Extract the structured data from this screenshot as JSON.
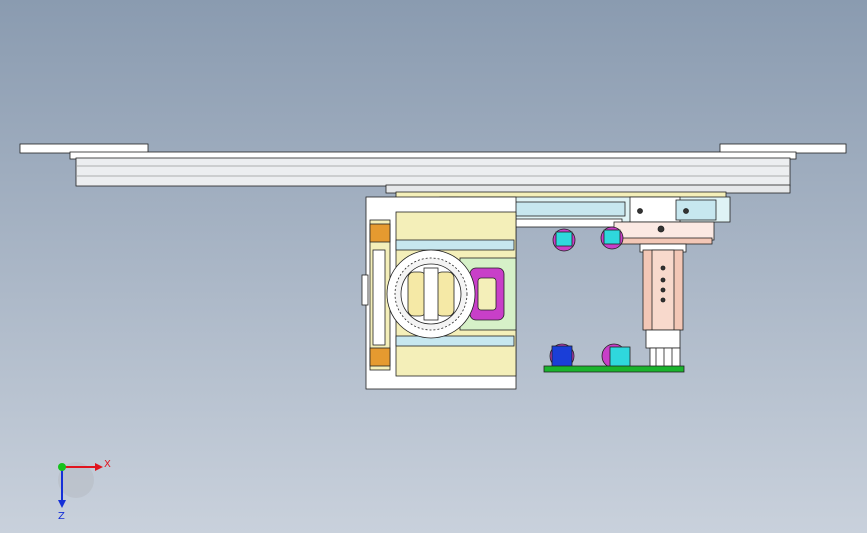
{
  "viewport": {
    "background_top": "#8a9bb0",
    "background_bottom": "#c9d1dc"
  },
  "triad": {
    "x_label": "X",
    "z_label": "Z",
    "x_color": "#e0141e",
    "y_color": "#16c21c",
    "z_color": "#1530d8"
  },
  "colors": {
    "plate_white": "#ffffff",
    "rail_gray": "#d8dadc",
    "panel_yellow": "#f4efb9",
    "cylinder_pink": "#f3c7b6",
    "slot_magenta": "#c83fc8",
    "block_cyan": "#2fd8dd",
    "block_blue": "#1a3ed8",
    "base_green": "#1ab42d",
    "ring_white": "#f4f4f4",
    "roller_yellow": "#f5e9a6",
    "orange_clamp": "#e59a30",
    "lime_plate": "#d6f1c8",
    "light_blue": "#c7e7ef"
  }
}
